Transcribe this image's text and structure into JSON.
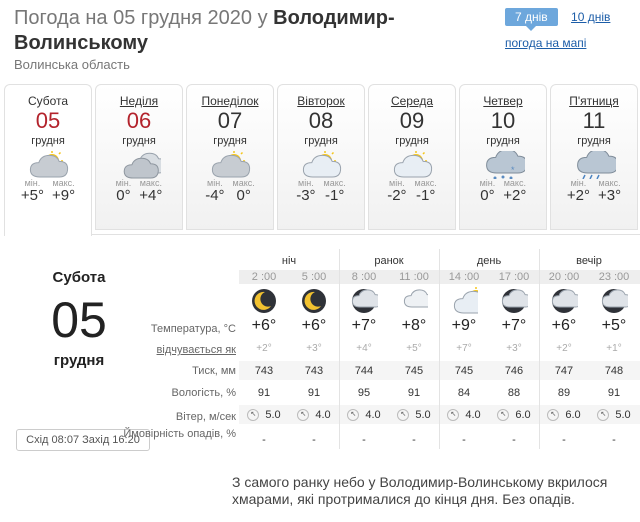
{
  "header": {
    "title_prefix": "Погода на 05 грудня 2020 у ",
    "title_city": "Володимир-Волинському",
    "region": "Волинська область"
  },
  "periods": {
    "active": "7 днів",
    "other": "10 днів",
    "map": "погода на мапі"
  },
  "days": [
    {
      "dow": "Субота",
      "day": "05",
      "month": "грудня",
      "min_label": "мін.",
      "max_label": "макс.",
      "min": "+5°",
      "max": "+9°",
      "icon": "cloud-sun-icon",
      "red": true
    },
    {
      "dow": "Неділя",
      "day": "06",
      "month": "грудня",
      "min_label": "мін.",
      "max_label": "макс.",
      "min": "0°",
      "max": "+4°",
      "icon": "cloud-icon",
      "red": true
    },
    {
      "dow": "Понеділок",
      "day": "07",
      "month": "грудня",
      "min_label": "мін.",
      "max_label": "макс.",
      "min": "-4°",
      "max": "0°",
      "icon": "cloud-sun-icon",
      "red": false
    },
    {
      "dow": "Вівторок",
      "day": "08",
      "month": "грудня",
      "min_label": "мін.",
      "max_label": "макс.",
      "min": "-3°",
      "max": "-1°",
      "icon": "sun-cloud-icon",
      "red": false
    },
    {
      "dow": "Середа",
      "day": "09",
      "month": "грудня",
      "min_label": "мін.",
      "max_label": "макс.",
      "min": "-2°",
      "max": "-1°",
      "icon": "sun-cloud-icon",
      "red": false
    },
    {
      "dow": "Четвер",
      "day": "10",
      "month": "грудня",
      "min_label": "мін.",
      "max_label": "макс.",
      "min": "0°",
      "max": "+2°",
      "icon": "snow-cloud-icon",
      "red": false
    },
    {
      "dow": "П'ятниця",
      "day": "11",
      "month": "грудня",
      "min_label": "мін.",
      "max_label": "макс.",
      "min": "+2°",
      "max": "+3°",
      "icon": "rain-cloud-icon",
      "red": false
    }
  ],
  "detail": {
    "dow": "Субота",
    "day": "05",
    "month": "грудня",
    "sun": "Схід 08:07 Захід 16:20",
    "segments": [
      "ніч",
      "ранок",
      "день",
      "вечір"
    ],
    "labels": {
      "temp": "Температура, °C",
      "feels": "відчувається як",
      "pressure": "Тиск, мм",
      "humidity": "Вологість, %",
      "wind": "Вітер, м/сек",
      "precip": "Ймовірність опадів, %"
    },
    "hours": [
      {
        "time": "2 :00",
        "icon": "moon-cloud-icon",
        "temp": "+6°",
        "feels": "+2°",
        "pressure": "743",
        "humidity": "91",
        "wind": "5.0",
        "precip": "-"
      },
      {
        "time": "5 :00",
        "icon": "moon-cloud-icon",
        "temp": "+6°",
        "feels": "+3°",
        "pressure": "743",
        "humidity": "91",
        "wind": "4.0",
        "precip": "-"
      },
      {
        "time": "8 :00",
        "icon": "overcast-icon",
        "temp": "+7°",
        "feels": "+4°",
        "pressure": "744",
        "humidity": "95",
        "wind": "4.0",
        "precip": "-"
      },
      {
        "time": "11 :00",
        "icon": "light-cloud-icon",
        "temp": "+8°",
        "feels": "+5°",
        "pressure": "745",
        "humidity": "91",
        "wind": "5.0",
        "precip": "-"
      },
      {
        "time": "14 :00",
        "icon": "sun-cloud-icon",
        "temp": "+9°",
        "feels": "+7°",
        "pressure": "745",
        "humidity": "84",
        "wind": "4.0",
        "precip": "-"
      },
      {
        "time": "17 :00",
        "icon": "overcast-icon",
        "temp": "+7°",
        "feels": "+3°",
        "pressure": "746",
        "humidity": "88",
        "wind": "6.0",
        "precip": "-"
      },
      {
        "time": "20 :00",
        "icon": "overcast-icon",
        "temp": "+6°",
        "feels": "+2°",
        "pressure": "747",
        "humidity": "89",
        "wind": "6.0",
        "precip": "-"
      },
      {
        "time": "23 :00",
        "icon": "overcast-icon",
        "temp": "+5°",
        "feels": "+1°",
        "pressure": "748",
        "humidity": "91",
        "wind": "5.0",
        "precip": "-"
      }
    ],
    "description": "З самого ранку небо у Володимир-Волинському вкрилося хмарами, які протрималися до кінця дня. Без опадів."
  }
}
